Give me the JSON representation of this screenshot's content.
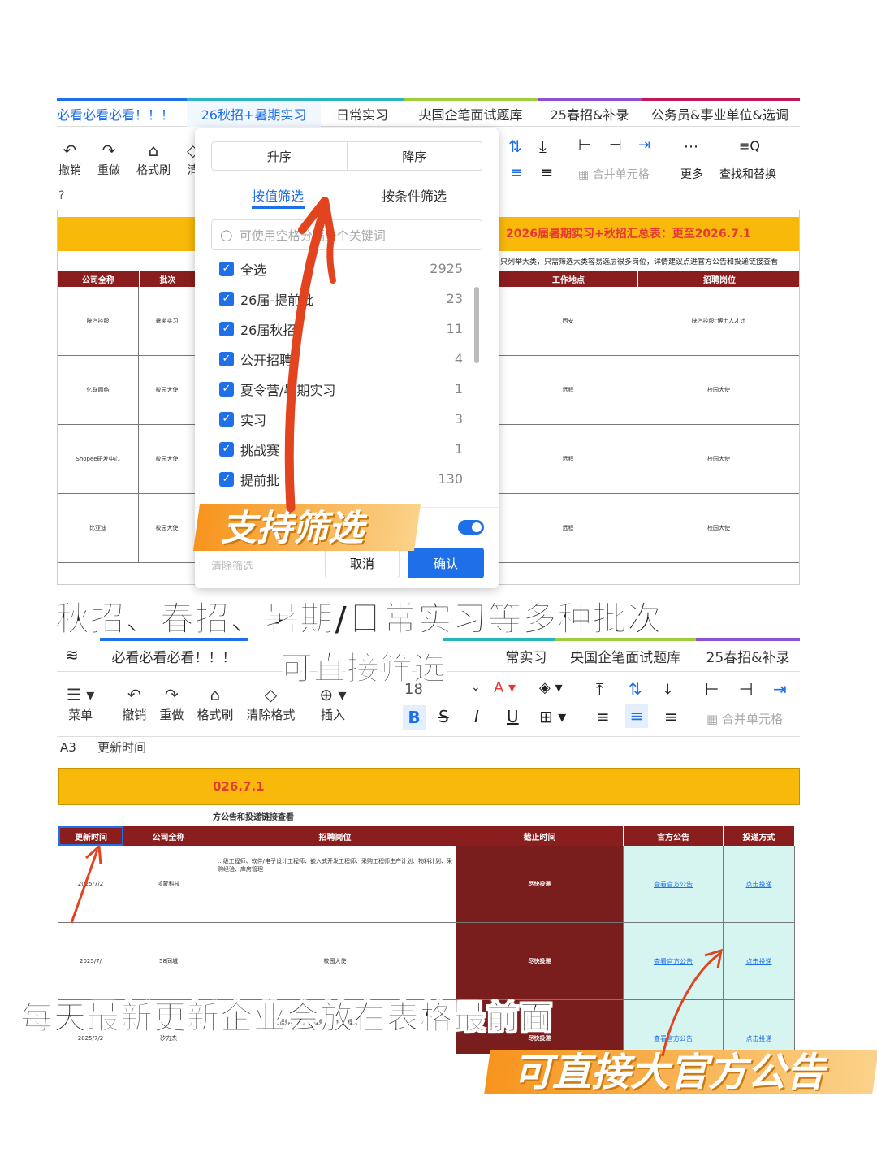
{
  "top": {
    "tabs": [
      "必看必看必看！！！",
      "26秋招+暑期实习",
      "日常实习",
      "央国企笔面试题库",
      "25春招&补录",
      "公务员&事业单位&选调"
    ],
    "toolbar": [
      "撤销",
      "重做",
      "格式刷",
      "清",
      "更多",
      "查找和替换",
      "合并单元格"
    ],
    "formula_prefix": "?",
    "banner": "2026届暑期实习+秋招汇总表：更至2026.7.1",
    "note": "只列举大类，只需筛选大类容易选层很多岗位，详情建议点进官方公告和投递链接查看",
    "headers": [
      "公司全称",
      "批次",
      "工作地点",
      "招聘岗位"
    ],
    "rows": [
      [
        "陕汽控股",
        "暑期实习",
        "西安",
        "陕汽控股“博士人才计"
      ],
      [
        "亿联网络",
        "校园大使",
        "远程",
        "校园大使"
      ],
      [
        "Shopee研发中心",
        "校园大使",
        "远程",
        "校园大使"
      ],
      [
        "比亚迪",
        "校园大使",
        "远程",
        "校园大使"
      ]
    ]
  },
  "filter": {
    "sort_asc": "升序",
    "sort_desc": "降序",
    "tab_value": "按值筛选",
    "tab_cond": "按条件筛选",
    "search_placeholder": "可使用空格分隔多个关键词",
    "items": [
      {
        "label": "全选",
        "count": "2925"
      },
      {
        "label": "26届-提前批",
        "count": "23"
      },
      {
        "label": "26届秋招",
        "count": "11"
      },
      {
        "label": "公开招聘",
        "count": "4"
      },
      {
        "label": "夏令营/暑期实习",
        "count": "1"
      },
      {
        "label": "实习",
        "count": "3"
      },
      {
        "label": "挑战赛",
        "count": "1"
      },
      {
        "label": "提前批",
        "count": "130"
      }
    ],
    "clear": "清除筛选",
    "cancel": "取消",
    "confirm": "确认"
  },
  "overlays": {
    "support_filter": "支持筛选",
    "line1": "秋招、春招、暑期/日常实习等多种批次",
    "line2": "可直接筛选",
    "line3": "每天最新更新企业会放在表格最前面",
    "line4": "可直接大官方公告"
  },
  "bottom": {
    "tabs": [
      "必看必看必看！！！",
      "常实习",
      "央国企笔面试题库",
      "25春招&补录"
    ],
    "toolbar": [
      "菜单",
      "撤销",
      "重做",
      "格式刷",
      "清除格式",
      "插入",
      "合并单元格"
    ],
    "font_size": "18",
    "cell_ref": "A3",
    "cell_value": "更新时间",
    "banner": "026.7.1",
    "note": "方公告和投递链接查看",
    "headers": [
      "更新时间",
      "公司全称",
      "招聘岗位",
      "截止时间",
      "官方公告",
      "投递方式"
    ],
    "rows": [
      [
        "2025/7/2",
        "鸿蒙科技",
        "",
        "尽快投递",
        "查看官方公告",
        "点击投递"
      ],
      [
        "2025/7/",
        "58同城",
        "校园大使",
        "尽快投递",
        "查看官方公告",
        "点击投递"
      ],
      [
        "2025/7/2",
        "矽力杰",
        "",
        "尽快投递",
        "查看官方公告",
        "点击投递"
      ]
    ],
    "row1_jobs": "...级工程师、软件/电子设计工程师、嵌入式开发工程师、采购工程师生产计划、物料计划、采购经验、库房管理",
    "row3_jobs": "...工程师、品质工程师、销售工程师"
  },
  "colors": {
    "accent": "#1e6fe8",
    "banner": "#f8b90b",
    "header": "#8a1e1e",
    "arrow": "#e2441f"
  }
}
